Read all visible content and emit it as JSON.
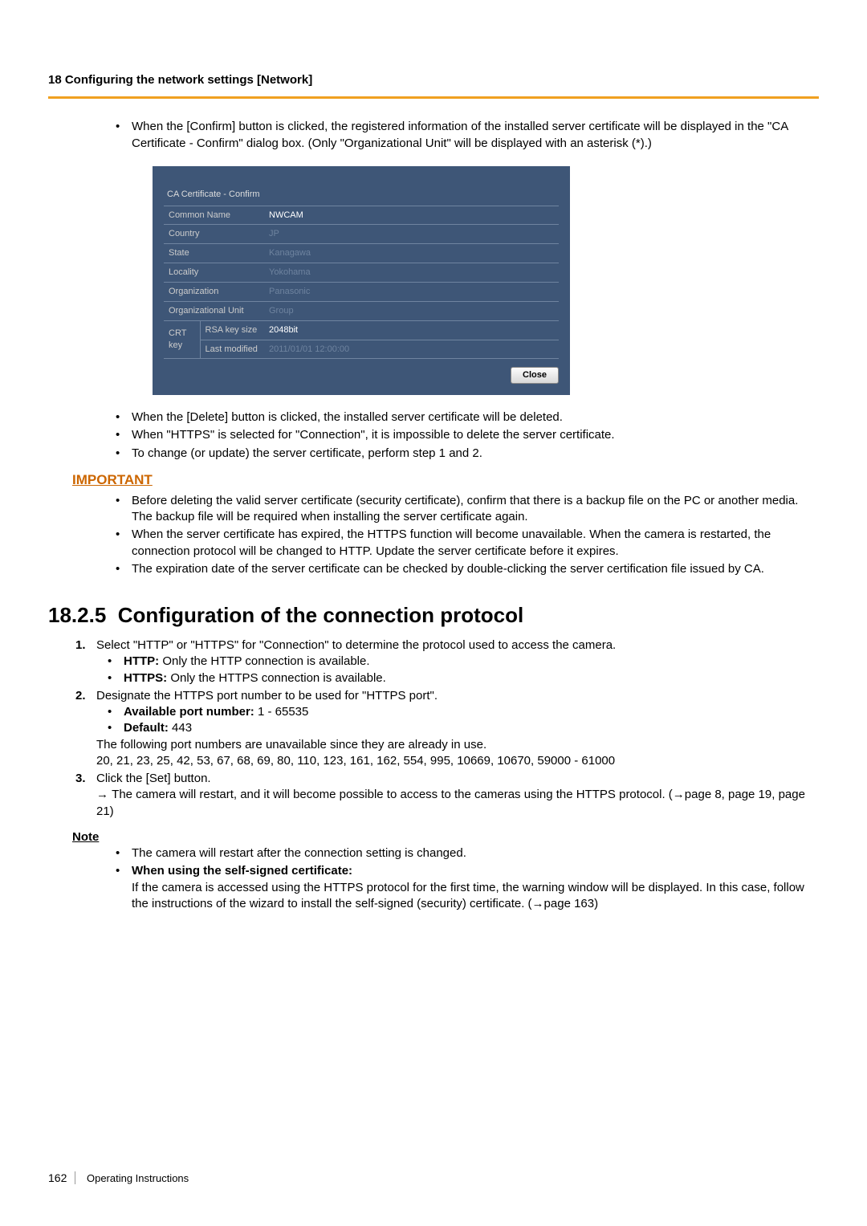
{
  "header": {
    "title": "18 Configuring the network settings [Network]"
  },
  "intro_bullet": "When the [Confirm] button is clicked, the registered information of the installed server certificate will be displayed in the \"CA Certificate - Confirm\" dialog box. (Only \"Organizational Unit\" will be displayed with an asterisk (*).)",
  "dialog": {
    "title": "CA Certificate - Confirm",
    "rows": [
      {
        "label": "Common Name",
        "value": "NWCAM",
        "redacted": false
      },
      {
        "label": "Country",
        "value": "JP",
        "redacted": true
      },
      {
        "label": "State",
        "value": "Kanagawa",
        "redacted": true
      },
      {
        "label": "Locality",
        "value": "Yokohama",
        "redacted": true
      },
      {
        "label": "Organization",
        "value": "Panasonic",
        "redacted": true
      },
      {
        "label": "Organizational Unit",
        "value": "Group",
        "redacted": true
      }
    ],
    "crt_label": "CRT key",
    "crt_rows": [
      {
        "sublabel": "RSA key size",
        "value": "2048bit",
        "redacted": false
      },
      {
        "sublabel": "Last modified",
        "value": "2011/01/01 12:00:00",
        "redacted": true
      }
    ],
    "close_label": "Close"
  },
  "post_dialog_bullets": [
    "When the [Delete] button is clicked, the installed server certificate will be deleted.",
    "When \"HTTPS\" is selected for \"Connection\", it is impossible to delete the server certificate.",
    "To change (or update) the server certificate, perform step 1 and 2."
  ],
  "important": {
    "label": "IMPORTANT",
    "bullets": [
      "Before deleting the valid server certificate (security certificate), confirm that there is a backup file on the PC or another media. The backup file will be required when installing the server certificate again.",
      "When the server certificate has expired, the HTTPS function will become unavailable. When the camera is restarted, the connection protocol will be changed to HTTP. Update the server certificate before it expires.",
      "The expiration date of the server certificate can be checked by double-clicking the server certification file issued by CA."
    ]
  },
  "section": {
    "number": "18.2.5",
    "title": "Configuration of the connection protocol"
  },
  "steps": {
    "s1": {
      "num": "1.",
      "text": "Select \"HTTP\" or \"HTTPS\" for \"Connection\" to determine the protocol used to access the camera.",
      "sub_http_label": "HTTP:",
      "sub_http_text": " Only the HTTP connection is available.",
      "sub_https_label": "HTTPS:",
      "sub_https_text": " Only the HTTPS connection is available."
    },
    "s2": {
      "num": "2.",
      "text": "Designate the HTTPS port number to be used for \"HTTPS port\".",
      "port_label": "Available port number:",
      "port_text": " 1 - 65535",
      "default_label": "Default:",
      "default_text": " 443",
      "unavailable_intro": "The following port numbers are unavailable since they are already in use.",
      "unavailable_list": "20, 21, 23, 25, 42, 53, 67, 68, 69, 80, 110, 123, 161, 162, 554, 995, 10669, 10670, 59000 - 61000"
    },
    "s3": {
      "num": "3.",
      "text": "Click the [Set] button.",
      "arrow": "→",
      "result": "The camera will restart, and it will become possible to access to the cameras using the HTTPS protocol. (→page 8, page 19, page 21)"
    }
  },
  "note": {
    "label": "Note",
    "b1": "The camera will restart after the connection setting is changed.",
    "b2_label": "When using the self-signed certificate:",
    "b2_text": "If the camera is accessed using the HTTPS protocol for the first time, the warning window will be displayed. In this case, follow the instructions of the wizard to install the self-signed (security) certificate. (→page 163)"
  },
  "footer": {
    "page": "162",
    "doc": "Operating Instructions"
  }
}
